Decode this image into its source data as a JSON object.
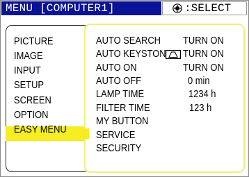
{
  "header": {
    "title": "MENU [COMPUTER1]",
    "select_hint": ":SELECT",
    "select_icon": "joystick-icon"
  },
  "main_menu": {
    "items": [
      "PICTURE",
      "IMAGE",
      "INPUT",
      "SETUP",
      "SCREEN",
      "OPTION",
      "EASY MENU"
    ],
    "selected": "OPTION"
  },
  "option_menu": {
    "items": [
      {
        "label": "AUTO SEARCH",
        "value": "TURN ON"
      },
      {
        "label": "AUTO KEYSTONE",
        "value": "TURN ON",
        "icon": "keystone-icon"
      },
      {
        "label": "AUTO ON",
        "value": "TURN ON"
      },
      {
        "label": "AUTO OFF",
        "value": "0 min"
      },
      {
        "label": "LAMP TIME",
        "value": "1234 h"
      },
      {
        "label": "FILTER TIME",
        "value": "123 h"
      },
      {
        "label": "MY BUTTON",
        "value": ""
      },
      {
        "label": "SERVICE",
        "value": ""
      },
      {
        "label": "SECURITY",
        "value": ""
      }
    ]
  },
  "colors": {
    "title_bar": "#0a1296",
    "highlight": "#f6ee22",
    "panel_border": "#f2ee75"
  }
}
